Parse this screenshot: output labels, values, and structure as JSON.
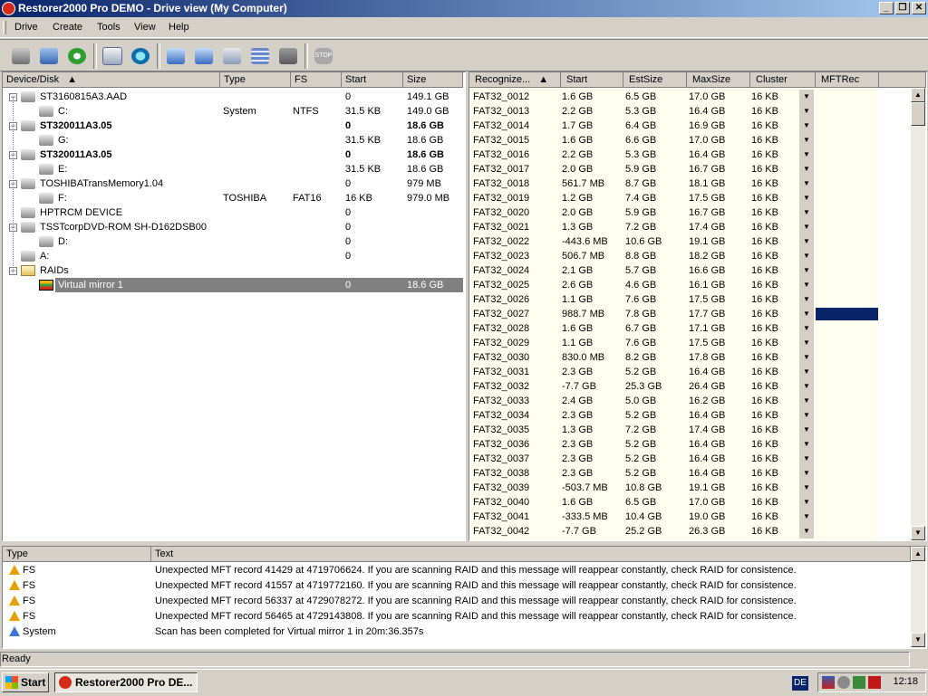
{
  "window": {
    "title": "Restorer2000 Pro DEMO - Drive view (My Computer)"
  },
  "menu": [
    "Drive",
    "Create",
    "Tools",
    "View",
    "Help"
  ],
  "toolbar_icons": [
    "computer-icon",
    "network-computer-icon",
    "refresh-icon",
    "copy-icon",
    "scan-icon",
    "disk-image-icon",
    "disk-open-icon",
    "region-icon",
    "raid-icon",
    "disconnect-icon",
    "stop-icon"
  ],
  "left": {
    "headers": {
      "device": "Device/Disk",
      "type": "Type",
      "fs": "FS",
      "start": "Start",
      "size": "Size"
    },
    "rows": [
      {
        "name": "ST3160815A3.AAD",
        "type": "",
        "fs": "",
        "start": "0",
        "size": "149.1 GB",
        "level": 0,
        "bold": false
      },
      {
        "name": "C:",
        "type": "System",
        "fs": "NTFS",
        "start": "31.5 KB",
        "size": "149.0 GB",
        "level": 1,
        "bold": false
      },
      {
        "name": "ST320011A3.05",
        "type": "",
        "fs": "",
        "start": "0",
        "size": "18.6 GB",
        "level": 0,
        "bold": true
      },
      {
        "name": "G:",
        "type": "",
        "fs": "",
        "start": "31.5 KB",
        "size": "18.6 GB",
        "level": 1,
        "bold": false
      },
      {
        "name": "ST320011A3.05",
        "type": "",
        "fs": "",
        "start": "0",
        "size": "18.6 GB",
        "level": 0,
        "bold": true
      },
      {
        "name": "E:",
        "type": "",
        "fs": "",
        "start": "31.5 KB",
        "size": "18.6 GB",
        "level": 1,
        "bold": false
      },
      {
        "name": "TOSHIBATransMemory1.04",
        "type": "",
        "fs": "",
        "start": "0",
        "size": "979 MB",
        "level": 0,
        "bold": false
      },
      {
        "name": "F:",
        "type": "TOSHIBA",
        "fs": "FAT16",
        "start": "16 KB",
        "size": "979.0 MB",
        "level": 1,
        "bold": false
      },
      {
        "name": "HPTRCM DEVICE",
        "type": "",
        "fs": "",
        "start": "0",
        "size": "",
        "level": 0,
        "bold": false
      },
      {
        "name": "TSSTcorpDVD-ROM SH-D162DSB00",
        "type": "",
        "fs": "",
        "start": "0",
        "size": "",
        "level": 0,
        "bold": false
      },
      {
        "name": "D:",
        "type": "",
        "fs": "",
        "start": "0",
        "size": "",
        "level": 1,
        "bold": false
      },
      {
        "name": "A:",
        "type": "",
        "fs": "",
        "start": "0",
        "size": "",
        "level": 0,
        "bold": false
      },
      {
        "name": "RAIDs",
        "type": "",
        "fs": "",
        "start": "",
        "size": "",
        "level": 0,
        "bold": false
      },
      {
        "name": "Virtual mirror 1",
        "type": "",
        "fs": "",
        "start": "0",
        "size": "18.6 GB",
        "level": 1,
        "bold": false,
        "selected": true
      }
    ]
  },
  "right": {
    "headers": {
      "name": "Recognize...",
      "start": "Start",
      "est": "EstSize",
      "max": "MaxSize",
      "cluster": "Cluster",
      "mft": "MFTRec"
    },
    "rows": [
      {
        "name": "FAT32_0012",
        "start": "1.6 GB",
        "est": "6.5 GB",
        "max": "17.0 GB",
        "cluster": "16 KB"
      },
      {
        "name": "FAT32_0013",
        "start": "2.2 GB",
        "est": "5.3 GB",
        "max": "16.4 GB",
        "cluster": "16 KB"
      },
      {
        "name": "FAT32_0014",
        "start": "1.7 GB",
        "est": "6.4 GB",
        "max": "16.9 GB",
        "cluster": "16 KB"
      },
      {
        "name": "FAT32_0015",
        "start": "1.6 GB",
        "est": "6.6 GB",
        "max": "17.0 GB",
        "cluster": "16 KB"
      },
      {
        "name": "FAT32_0016",
        "start": "2.2 GB",
        "est": "5.3 GB",
        "max": "16.4 GB",
        "cluster": "16 KB"
      },
      {
        "name": "FAT32_0017",
        "start": "2.0 GB",
        "est": "5.9 GB",
        "max": "16.7 GB",
        "cluster": "16 KB"
      },
      {
        "name": "FAT32_0018",
        "start": "561.7 MB",
        "est": "8.7 GB",
        "max": "18.1 GB",
        "cluster": "16 KB"
      },
      {
        "name": "FAT32_0019",
        "start": "1.2 GB",
        "est": "7.4 GB",
        "max": "17.5 GB",
        "cluster": "16 KB"
      },
      {
        "name": "FAT32_0020",
        "start": "2.0 GB",
        "est": "5.9 GB",
        "max": "16.7 GB",
        "cluster": "16 KB"
      },
      {
        "name": "FAT32_0021",
        "start": "1.3 GB",
        "est": "7.2 GB",
        "max": "17.4 GB",
        "cluster": "16 KB"
      },
      {
        "name": "FAT32_0022",
        "start": "-443.6 MB",
        "est": "10.6 GB",
        "max": "19.1 GB",
        "cluster": "16 KB"
      },
      {
        "name": "FAT32_0023",
        "start": "506.7 MB",
        "est": "8.8 GB",
        "max": "18.2 GB",
        "cluster": "16 KB"
      },
      {
        "name": "FAT32_0024",
        "start": "2.1 GB",
        "est": "5.7 GB",
        "max": "16.6 GB",
        "cluster": "16 KB"
      },
      {
        "name": "FAT32_0025",
        "start": "2.6 GB",
        "est": "4.6 GB",
        "max": "16.1 GB",
        "cluster": "16 KB"
      },
      {
        "name": "FAT32_0026",
        "start": "1.1 GB",
        "est": "7.6 GB",
        "max": "17.5 GB",
        "cluster": "16 KB"
      },
      {
        "name": "FAT32_0027",
        "start": "988.7 MB",
        "est": "7.8 GB",
        "max": "17.7 GB",
        "cluster": "16 KB",
        "mftSelected": true
      },
      {
        "name": "FAT32_0028",
        "start": "1.6 GB",
        "est": "6.7 GB",
        "max": "17.1 GB",
        "cluster": "16 KB"
      },
      {
        "name": "FAT32_0029",
        "start": "1.1 GB",
        "est": "7.6 GB",
        "max": "17.5 GB",
        "cluster": "16 KB"
      },
      {
        "name": "FAT32_0030",
        "start": "830.0 MB",
        "est": "8.2 GB",
        "max": "17.8 GB",
        "cluster": "16 KB"
      },
      {
        "name": "FAT32_0031",
        "start": "2.3 GB",
        "est": "5.2 GB",
        "max": "16.4 GB",
        "cluster": "16 KB"
      },
      {
        "name": "FAT32_0032",
        "start": "-7.7 GB",
        "est": "25.3 GB",
        "max": "26.4 GB",
        "cluster": "16 KB"
      },
      {
        "name": "FAT32_0033",
        "start": "2.4 GB",
        "est": "5.0 GB",
        "max": "16.2 GB",
        "cluster": "16 KB"
      },
      {
        "name": "FAT32_0034",
        "start": "2.3 GB",
        "est": "5.2 GB",
        "max": "16.4 GB",
        "cluster": "16 KB"
      },
      {
        "name": "FAT32_0035",
        "start": "1.3 GB",
        "est": "7.2 GB",
        "max": "17.4 GB",
        "cluster": "16 KB"
      },
      {
        "name": "FAT32_0036",
        "start": "2.3 GB",
        "est": "5.2 GB",
        "max": "16.4 GB",
        "cluster": "16 KB"
      },
      {
        "name": "FAT32_0037",
        "start": "2.3 GB",
        "est": "5.2 GB",
        "max": "16.4 GB",
        "cluster": "16 KB"
      },
      {
        "name": "FAT32_0038",
        "start": "2.3 GB",
        "est": "5.2 GB",
        "max": "16.4 GB",
        "cluster": "16 KB"
      },
      {
        "name": "FAT32_0039",
        "start": "-503.7 MB",
        "est": "10.8 GB",
        "max": "19.1 GB",
        "cluster": "16 KB"
      },
      {
        "name": "FAT32_0040",
        "start": "1.6 GB",
        "est": "6.5 GB",
        "max": "17.0 GB",
        "cluster": "16 KB"
      },
      {
        "name": "FAT32_0041",
        "start": "-333.5 MB",
        "est": "10.4 GB",
        "max": "19.0 GB",
        "cluster": "16 KB"
      },
      {
        "name": "FAT32_0042",
        "start": "-7.7 GB",
        "est": "25.2 GB",
        "max": "26.3 GB",
        "cluster": "16 KB"
      }
    ]
  },
  "log": {
    "headers": {
      "type": "Type",
      "text": "Text"
    },
    "rows": [
      {
        "kind": "warning",
        "type": "FS",
        "text": "Unexpected MFT record 41429 at 4719706624. If you are scanning RAID and this message will reappear constantly, check RAID for consistence."
      },
      {
        "kind": "warning",
        "type": "FS",
        "text": "Unexpected MFT record 41557 at 4719772160. If you are scanning RAID and this message will reappear constantly, check RAID for consistence."
      },
      {
        "kind": "warning",
        "type": "FS",
        "text": "Unexpected MFT record 56337 at 4729078272. If you are scanning RAID and this message will reappear constantly, check RAID for consistence."
      },
      {
        "kind": "warning",
        "type": "FS",
        "text": "Unexpected MFT record 56465 at 4729143808. If you are scanning RAID and this message will reappear constantly, check RAID for consistence."
      },
      {
        "kind": "info",
        "type": "System",
        "text": "Scan has been completed for Virtual mirror 1 in 20m:36.357s"
      }
    ]
  },
  "status": {
    "text": "Ready"
  },
  "taskbar": {
    "start": "Start",
    "task": "Restorer2000 Pro DE...",
    "lang": "DE",
    "clock": "12:18"
  },
  "colors": {
    "titlebar": "#0a246a",
    "selection": "#0a246a",
    "selectedRow": "#808080",
    "yellowColumn": "#fffff0"
  }
}
